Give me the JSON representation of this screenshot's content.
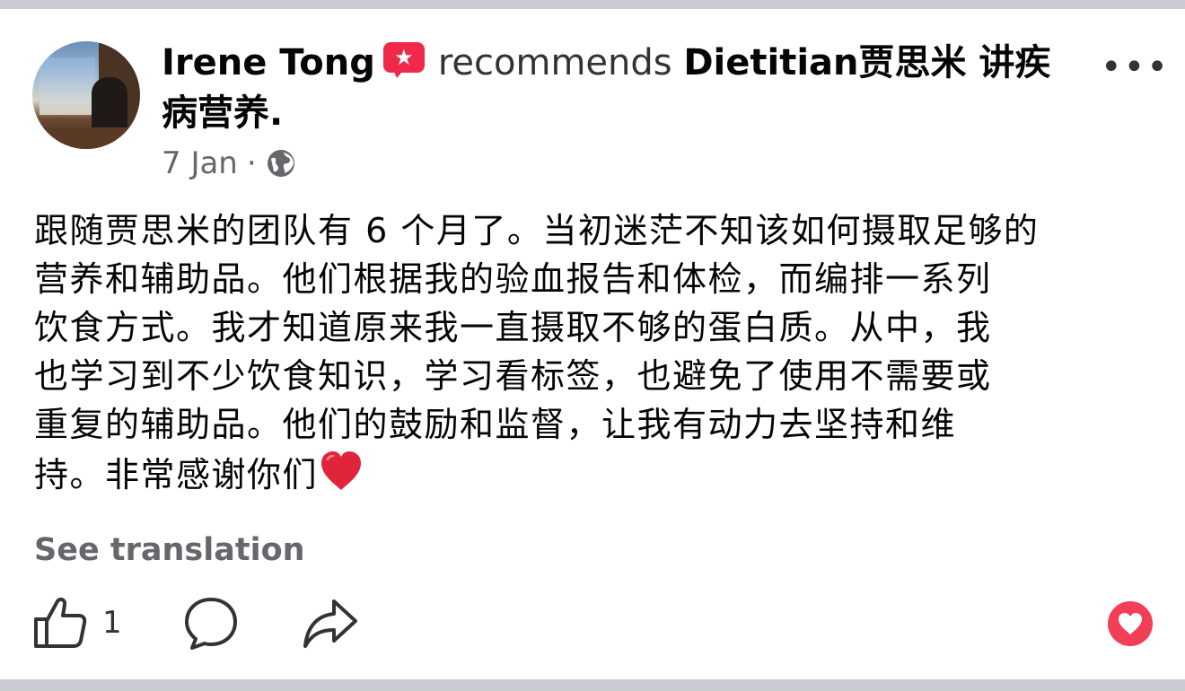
{
  "post": {
    "author": "Irene Tong",
    "action_text": "recommends",
    "page_name": "Dietitian贾思米 讲疾病营养.",
    "timestamp": "7 Jan",
    "separator": "·",
    "privacy_icon": "globe-icon",
    "recommend_badge_icon": "star-speech-bubble-icon",
    "body": "跟随贾思米的团队有 6 个月了。当初迷茫不知该如何摄取足够的\n营养和辅助品。他们根据我的验血报告和体检，而编排一系列\n饮食方式。我才知道原来我一直摄取不够的蛋白质。从中，我\n也学习到不少饮食知识，学习看标签，也避免了使用不需要或\n重复的辅助品。他们的鼓励和监督，让我有动力去坚持和维\n持。非常感谢你们",
    "body_emoji": "red-heart-emoji",
    "see_translation": "See translation",
    "more_label": "•••"
  },
  "actions": {
    "like_count": "1",
    "like_icon": "thumbs-up-icon",
    "comment_icon": "speech-bubble-icon",
    "share_icon": "share-arrow-icon",
    "reaction_icon": "love-reaction-icon"
  },
  "colors": {
    "text_primary": "#050505",
    "text_secondary": "#65676b",
    "divider_band": "#c9ccd1",
    "recommend_badge": "#f0284a",
    "love_reaction": "#f33e58"
  }
}
